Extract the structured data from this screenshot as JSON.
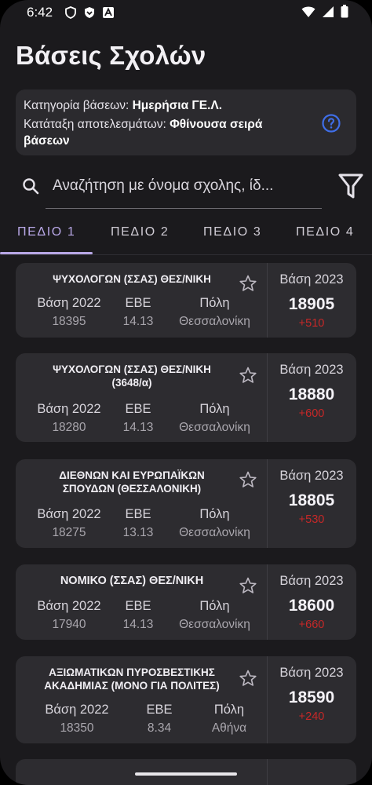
{
  "status": {
    "time": "6:42"
  },
  "page_title": "Βάσεις Σχολών",
  "info": {
    "category_label": "Κατηγορία βάσεων: ",
    "category_value": "Ημερήσια ΓΕ.Λ.",
    "sort_label": "Κατάταξη αποτελεσμάτων: ",
    "sort_value_line1": "Φθίνουσα σειρά",
    "sort_value_line2": "βάσεων"
  },
  "search": {
    "placeholder": "Αναζήτηση με όνομα σχολης, ίδ..."
  },
  "tabs": [
    {
      "label": "ΠΕΔΙΟ 1"
    },
    {
      "label": "ΠΕΔΙΟ 2"
    },
    {
      "label": "ΠΕΔΙΟ 3"
    },
    {
      "label": "ΠΕΔΙΟ 4"
    }
  ],
  "columns": {
    "base_prev": "Βάση 2022",
    "ebe": "ΕΒΕ",
    "city": "Πόλη",
    "base_curr": "Βάση 2023"
  },
  "schools": [
    {
      "name1": "ΨΥΧΟΛΟΓΩΝ (ΣΣΑΣ) ΘΕΣ/ΝΙΚΗ",
      "name2": "",
      "base_prev": "18395",
      "ebe": "14.13",
      "city": "Θεσσαλονίκη",
      "base_curr": "18905",
      "diff": "+510"
    },
    {
      "name1": "ΨΥΧΟΛΟΓΩΝ (ΣΣΑΣ) ΘΕΣ/ΝΙΚΗ",
      "name2": "(3648/α)",
      "base_prev": "18280",
      "ebe": "14.13",
      "city": "Θεσσαλονίκη",
      "base_curr": "18880",
      "diff": "+600"
    },
    {
      "name1": "ΔΙΕΘΝΩΝ ΚΑΙ ΕΥΡΩΠΑΪΚΩΝ",
      "name2": "ΣΠΟΥΔΩΝ (ΘΕΣΣΑΛΟΝΙΚΗ)",
      "base_prev": "18275",
      "ebe": "13.13",
      "city": "Θεσσαλονίκη",
      "base_curr": "18805",
      "diff": "+530"
    },
    {
      "name1": "ΝΟΜΙΚΟ (ΣΣΑΣ) ΘΕΣ/ΝΙΚΗ",
      "name2": "",
      "base_prev": "17940",
      "ebe": "14.13",
      "city": "Θεσσαλονίκη",
      "base_curr": "18600",
      "diff": "+660"
    },
    {
      "name1": "ΑΞΙΩΜΑΤΙΚΩΝ ΠΥΡΟΣΒΕΣΤΙΚΗΣ",
      "name2": "ΑΚΑΔΗΜΙΑΣ (ΜΟΝΟ ΓΙΑ ΠΟΛΙΤΕΣ)",
      "base_prev": "18350",
      "ebe": "8.34",
      "city": "Αθήνα",
      "base_curr": "18590",
      "diff": "+240"
    }
  ],
  "colors": {
    "accent": "#b8a7e6",
    "diff": "#c62828",
    "help": "#3f6ee8"
  }
}
